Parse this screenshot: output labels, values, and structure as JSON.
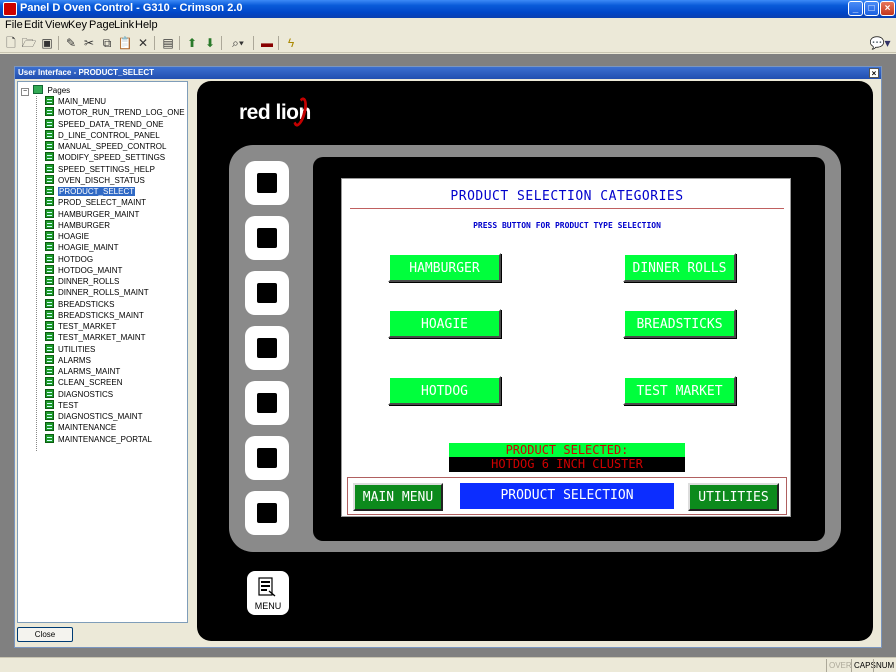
{
  "window": {
    "title": "Panel D Oven Control - G310 - Crimson 2.0"
  },
  "menu": [
    "File",
    "Edit",
    "View",
    "Key",
    "Page",
    "Link",
    "Help"
  ],
  "toolbar": {
    "icons": [
      "new-file-icon",
      "open-folder-icon",
      "save-icon",
      "pen-icon",
      "cut-icon",
      "copy-icon",
      "paste-icon",
      "delete-icon",
      "view-icon",
      "up-arrow-icon",
      "down-arrow-icon",
      "zoom-icon",
      "monitor-icon",
      "lightning-icon",
      "help-balloon-icon"
    ]
  },
  "child_window": {
    "title": "User Interface - PRODUCT_SELECT",
    "close_label": "Close"
  },
  "tree": {
    "root": "Pages",
    "items": [
      "MAIN_MENU",
      "MOTOR_RUN_TREND_LOG_ONE",
      "SPEED_DATA_TREND_ONE",
      "D_LINE_CONTROL_PANEL",
      "MANUAL_SPEED_CONTROL",
      "MODIFY_SPEED_SETTINGS",
      "SPEED_SETTINGS_HELP",
      "OVEN_DISCH_STATUS",
      "PRODUCT_SELECT",
      "PROD_SELECT_MAINT",
      "HAMBURGER_MAINT",
      "HAMBURGER",
      "HOAGIE",
      "HOAGIE_MAINT",
      "HOTDOG",
      "HOTDOG_MAINT",
      "DINNER_ROLLS",
      "DINNER_ROLLS_MAINT",
      "BREADSTICKS",
      "BREADSTICKS_MAINT",
      "TEST_MARKET",
      "TEST_MARKET_MAINT",
      "UTILITIES",
      "ALARMS",
      "ALARMS_MAINT",
      "CLEAN_SCREEN",
      "DIAGNOSTICS",
      "TEST",
      "DIAGNOSTICS_MAINT",
      "MAINTENANCE",
      "MAINTENANCE_PORTAL"
    ],
    "selected": "PRODUCT_SELECT"
  },
  "device": {
    "logo": "red lion",
    "menu_key_label": "MENU"
  },
  "display": {
    "title": "PRODUCT SELECTION CATEGORIES",
    "subtitle": "PRESS BUTTON FOR PRODUCT TYPE SELECTION",
    "buttons": {
      "hamburger": "HAMBURGER",
      "dinner_rolls": "DINNER ROLLS",
      "hoagie": "HOAGIE",
      "breadsticks": "BREADSTICKS",
      "hotdog": "HOTDOG",
      "test_market": "TEST MARKET"
    },
    "selected_label": "PRODUCT SELECTED:",
    "selected_value": "HOTDOG 6 INCH CLUSTER",
    "nav": {
      "main_menu": "MAIN MENU",
      "title": "PRODUCT SELECTION",
      "utilities": "UTILITIES"
    }
  },
  "status": {
    "over": "OVER",
    "caps": "CAPS",
    "num": "NUM"
  }
}
